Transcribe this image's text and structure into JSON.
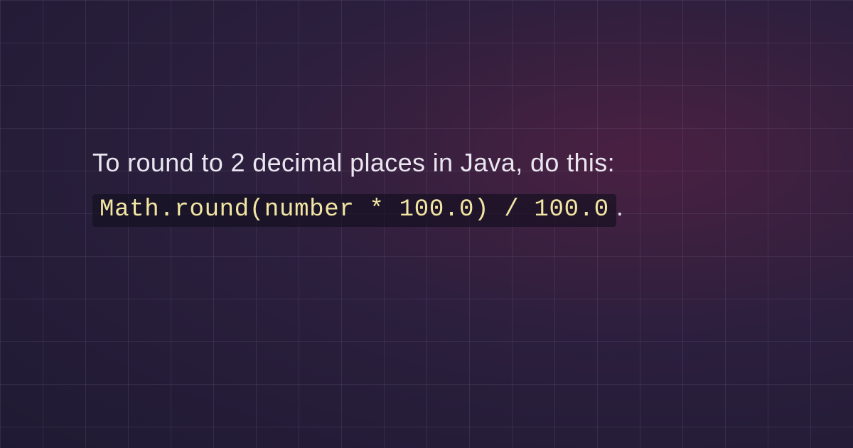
{
  "content": {
    "intro_text": "To round to 2 decimal places in Java, do this: ",
    "code_snippet": "Math.round(number * 100.0) / 100.0",
    "trailing_text": "."
  }
}
